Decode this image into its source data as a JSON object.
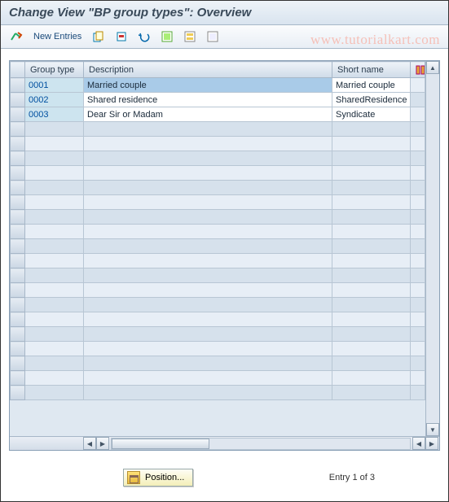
{
  "header": {
    "title": "Change View \"BP group types\": Overview"
  },
  "toolbar": {
    "new_entries_label": "New Entries"
  },
  "watermark": "www.tutorialkart.com",
  "table": {
    "columns": {
      "group_type": "Group type",
      "description": "Description",
      "short_name": "Short name"
    },
    "rows": [
      {
        "group_type": "0001",
        "description": "Married couple",
        "short_name": "Married couple",
        "selected": true
      },
      {
        "group_type": "0002",
        "description": "Shared residence",
        "short_name": "SharedResidence",
        "selected": false
      },
      {
        "group_type": "0003",
        "description": "Dear Sir or Madam",
        "short_name": "Syndicate",
        "selected": false
      }
    ],
    "blank_row_count": 19
  },
  "footer": {
    "position_label": "Position...",
    "entry_status": "Entry 1 of 3"
  }
}
